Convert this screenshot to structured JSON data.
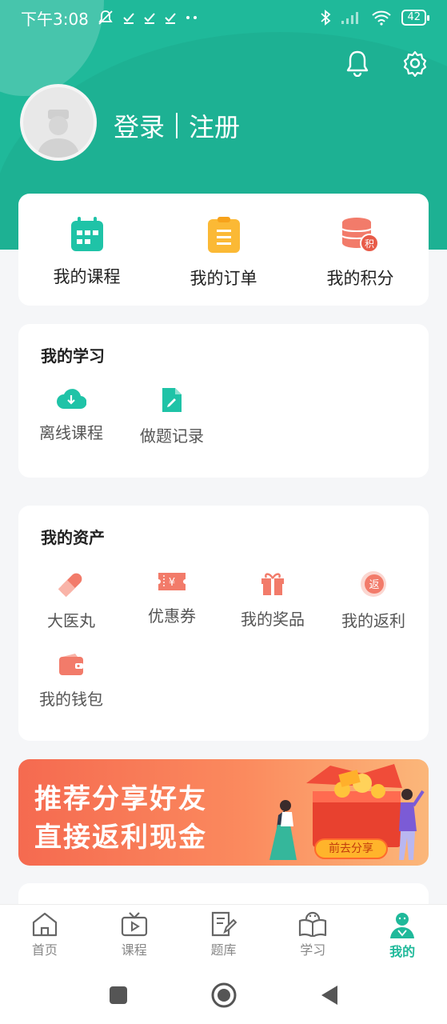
{
  "status_bar": {
    "time": "下午3:08",
    "battery": "42"
  },
  "header": {
    "login_label": "登录",
    "register_label": "注册"
  },
  "quick_links": [
    {
      "label": "我的课程",
      "icon": "calendar-icon"
    },
    {
      "label": "我的订单",
      "icon": "order-list-icon"
    },
    {
      "label": "我的积分",
      "icon": "points-coins-icon"
    }
  ],
  "study": {
    "title": "我的学习",
    "items": [
      {
        "label": "离线课程",
        "icon": "cloud-download-icon"
      },
      {
        "label": "做题记录",
        "icon": "edit-document-icon"
      }
    ]
  },
  "assets": {
    "title": "我的资产",
    "items": [
      {
        "label": "大医丸",
        "icon": "pill-icon"
      },
      {
        "label": "优惠券",
        "icon": "coupon-icon"
      },
      {
        "label": "我的奖品",
        "icon": "gift-icon"
      },
      {
        "label": "我的返利",
        "icon": "rebate-icon"
      },
      {
        "label": "我的钱包",
        "icon": "wallet-icon"
      }
    ]
  },
  "banner": {
    "line1": "推荐分享好友",
    "line2": "直接返利现金",
    "button": "前去分享"
  },
  "tabbar": {
    "items": [
      {
        "label": "首页",
        "icon": "home-icon"
      },
      {
        "label": "课程",
        "icon": "tv-play-icon"
      },
      {
        "label": "题库",
        "icon": "question-bank-icon"
      },
      {
        "label": "学习",
        "icon": "book-icon"
      },
      {
        "label": "我的",
        "icon": "profile-icon",
        "active": true
      }
    ]
  },
  "colors": {
    "brand": "#1fb99a",
    "accent_orange": "#f56a50",
    "icon_coral": "#f27b6a",
    "icon_yellow": "#fbb935"
  }
}
